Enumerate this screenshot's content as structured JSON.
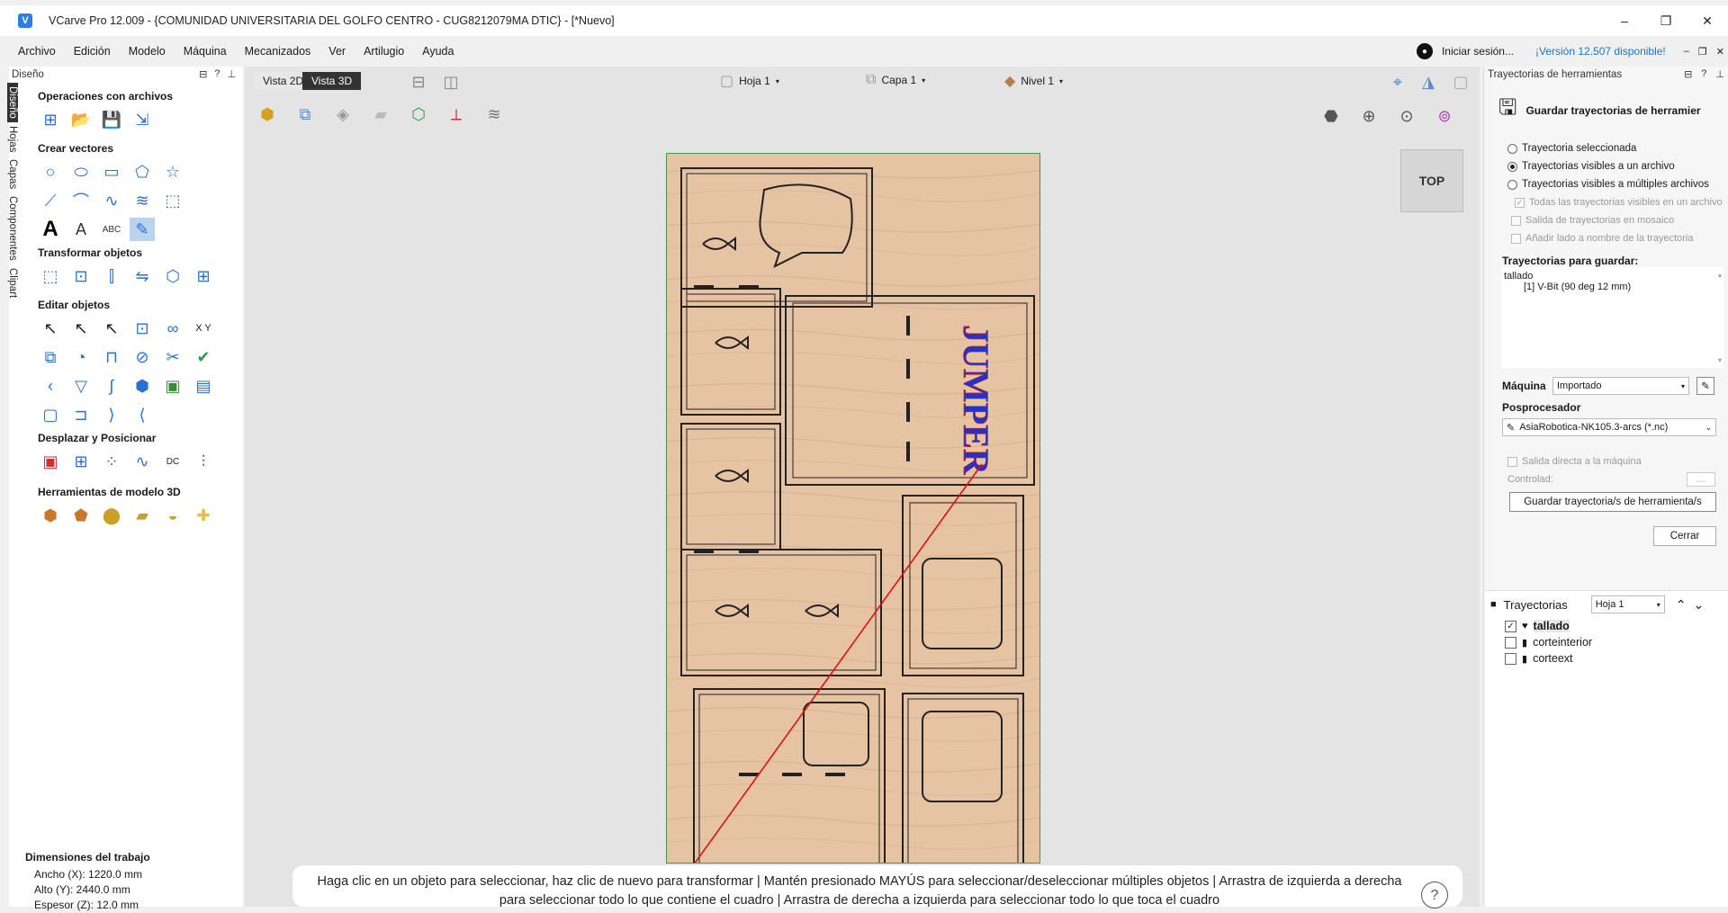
{
  "window": {
    "title": "VCarve Pro 12.009 - {COMUNIDAD UNIVERSITARIA DEL GOLFO CENTRO - CUG8212079MA DTIC} - [*Nuevo]",
    "controls": [
      "–",
      "❐",
      "✕"
    ]
  },
  "menu": {
    "items": [
      "Archivo",
      "Edición",
      "Modelo",
      "Máquina",
      "Mecanizados",
      "Ver",
      "Artilugio",
      "Ayuda"
    ],
    "login": "Iniciar sesión...",
    "version": "¡Versión 12.507 disponible!"
  },
  "left_panel": {
    "header": "Diseño",
    "vertical_tabs": [
      "Diseño",
      "Hojas",
      "Capas",
      "Componentes",
      "Clipart"
    ],
    "sections": [
      {
        "title": "Operaciones con archivos"
      },
      {
        "title": "Crear vectores"
      },
      {
        "title": "Transformar objetos"
      },
      {
        "title": "Editar objetos"
      },
      {
        "title": "Desplazar y Posicionar"
      },
      {
        "title": "Herramientas de modelo 3D"
      }
    ],
    "dimensions": {
      "title": "Dimensiones del trabajo",
      "width": "Ancho   (X): 1220.0 mm",
      "height": "Alto    (Y): 2440.0 mm",
      "thickness": "Espesor (Z): 12.0 mm"
    }
  },
  "view": {
    "tab_2d": "Vista 2D",
    "tab_3d": "Vista 3D",
    "sheet": "Hoja 1",
    "layer": "Capa 1",
    "level": "Nivel 1",
    "cube_label": "TOP",
    "carving_text": "JUMPER",
    "status": "Haga clic en un objeto para seleccionar, haz clic de nuevo para transformar | Mantén presionado MAYÚS para seleccionar/deseleccionar múltiples objetos | Arrastra de izquierda a derecha para seleccionar todo lo que contiene el cuadro | Arrastra de derecha a izquierda para seleccionar todo lo que toca el cuadro"
  },
  "right_panel": {
    "header": "Trayectorias de herramientas",
    "panel_title": "Guardar trayectorias de herramier",
    "radios": [
      {
        "label": "Trayectoria seleccionada",
        "selected": false
      },
      {
        "label": "Trayectorias visibles a un archivo",
        "selected": true
      },
      {
        "label": "Trayectorias visibles a múltiples archivos",
        "selected": false
      }
    ],
    "checks": [
      "Todas las trayectorias visibles en un archivo",
      "Salida de trayectorias en mosaico",
      "Añadir lado a nombre de la trayectoria"
    ],
    "to_save_title": "Trayectorias para guardar:",
    "to_save_items": [
      "tallado",
      "[1] V-Bit (90 deg 12 mm)"
    ],
    "machine_label": "Máquina",
    "machine_value": "Importado",
    "post_label": "Posprocesador",
    "post_value": "AsiaRobotica-NK105.3-arcs (*.nc)",
    "direct_output": "Salida directa a la máquina",
    "controller_label": "Controlad:",
    "controller_btn": "...",
    "save_btn": "Guardar trayectoria/s de herramienta/s",
    "close_btn": "Cerrar"
  },
  "trays": {
    "title": "Trayectorias",
    "sheet": "Hoja 1",
    "items": [
      {
        "label": "tallado",
        "checked": true
      },
      {
        "label": "corteinterior",
        "checked": false
      },
      {
        "label": "corteext",
        "checked": false
      }
    ]
  }
}
